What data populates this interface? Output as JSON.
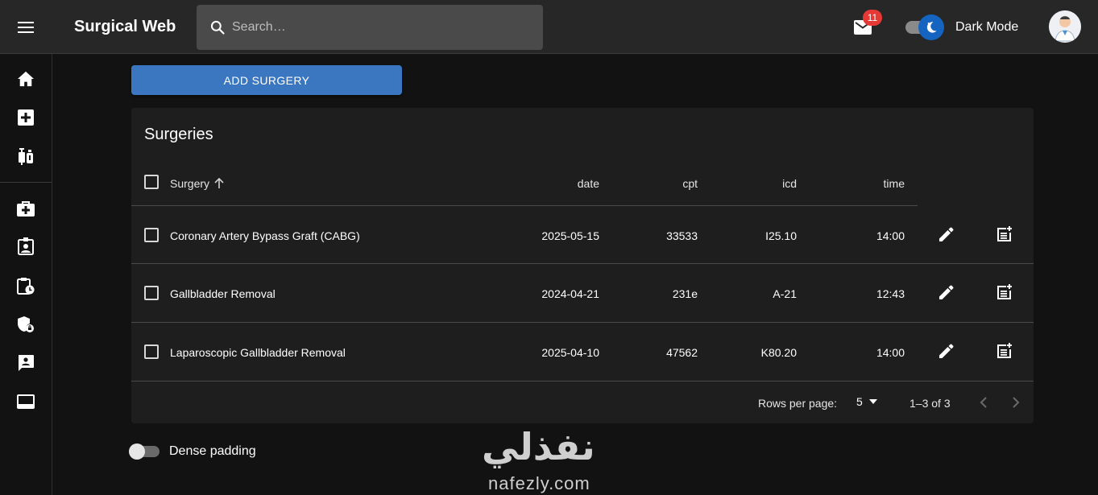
{
  "app": {
    "title": "Surgical Web"
  },
  "search": {
    "placeholder": "Search…"
  },
  "notifications": {
    "count": "11"
  },
  "theme": {
    "label": "Dark Mode"
  },
  "sidebar": {
    "items": [
      {
        "icon": "home-icon"
      },
      {
        "icon": "medical-plus-icon"
      },
      {
        "icon": "vaccines-icon"
      },
      {
        "icon": "medical-bag-icon"
      },
      {
        "icon": "id-badge-icon"
      },
      {
        "icon": "clipboard-clock-icon"
      },
      {
        "icon": "shield-lock-icon"
      },
      {
        "icon": "contact-card-icon"
      },
      {
        "icon": "monitor-icon"
      }
    ]
  },
  "toolbar": {
    "add_label": "ADD SURGERY"
  },
  "table": {
    "title": "Surgeries",
    "headers": {
      "surgery": "Surgery",
      "date": "date",
      "cpt": "cpt",
      "icd": "icd",
      "time": "time"
    },
    "rows": [
      {
        "surgery": "Coronary Artery Bypass Graft (CABG)",
        "date": "2025-05-15",
        "cpt": "33533",
        "icd": "I25.10",
        "time": "14:00"
      },
      {
        "surgery": "Gallbladder Removal",
        "date": "2024-04-21",
        "cpt": "231e",
        "icd": "A-21",
        "time": "12:43"
      },
      {
        "surgery": "Laparoscopic Gallbladder Removal",
        "date": "2025-04-10",
        "cpt": "47562",
        "icd": "K80.20",
        "time": "14:00"
      }
    ],
    "footer": {
      "rows_per_page_label": "Rows per page:",
      "rows_per_page_value": "5",
      "range": "1–3 of 3"
    }
  },
  "dense": {
    "label": "Dense padding"
  },
  "watermark": {
    "arabic": "نفذلي",
    "latin": "nafezly.com"
  }
}
